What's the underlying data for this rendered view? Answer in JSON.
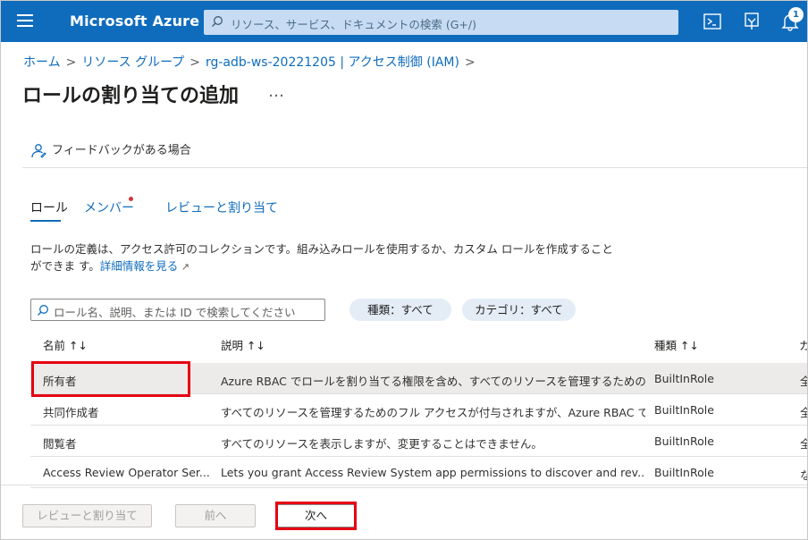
{
  "topbar": {
    "brand": "Microsoft Azure",
    "search_placeholder": "リソース、サービス、ドキュメントの検索 (G+/)",
    "notification_count": "1"
  },
  "breadcrumb": {
    "items": [
      "ホーム",
      "リソース グループ",
      "rg-adb-ws-20221205 | アクセス制御 (IAM)"
    ]
  },
  "page": {
    "title": "ロールの割り当ての追加",
    "more": "…",
    "feedback": "フィードバックがある場合"
  },
  "tabs": [
    "ロール",
    "メンバー",
    "レビューと割り当て"
  ],
  "description": {
    "text": "ロールの定義は、アクセス許可のコレクションです。組み込みロールを使用するか、カスタム ロールを作成することができま す。",
    "link": "詳細情報を見る"
  },
  "filters": {
    "search_placeholder": "ロール名、説明、または ID で検索してください",
    "type_pill": "種類：すべて",
    "category_pill": "カテゴリ：すべて"
  },
  "table": {
    "headers": {
      "name": "名前 ↑↓",
      "desc": "説明 ↑↓",
      "type": "種類 ↑↓",
      "cat": "カ"
    },
    "rows": [
      {
        "name": "所有者",
        "desc": "Azure RBAC でロールを割り当てる権限を含め、すべてのリソースを管理するためのフ...",
        "type": "BuiltInRole",
        "cat": "全"
      },
      {
        "name": "共同作成者",
        "desc": "すべてのリソースを管理するためのフル アクセスが付与されますが、Azure RBAC でロ...",
        "type": "BuiltInRole",
        "cat": "全"
      },
      {
        "name": "閲覧者",
        "desc": "すべてのリソースを表示しますが、変更することはできません。",
        "type": "BuiltInRole",
        "cat": "全"
      },
      {
        "name": "Access Review Operator Ser...",
        "desc": "Lets you grant Access Review System app permissions to discover and rev...",
        "type": "BuiltInRole",
        "cat": "な"
      }
    ]
  },
  "footer": {
    "review": "レビューと割り当て",
    "prev": "前へ",
    "next": "次へ"
  },
  "colors": {
    "accent": "#0f6cbd",
    "highlight": "#e60012"
  }
}
